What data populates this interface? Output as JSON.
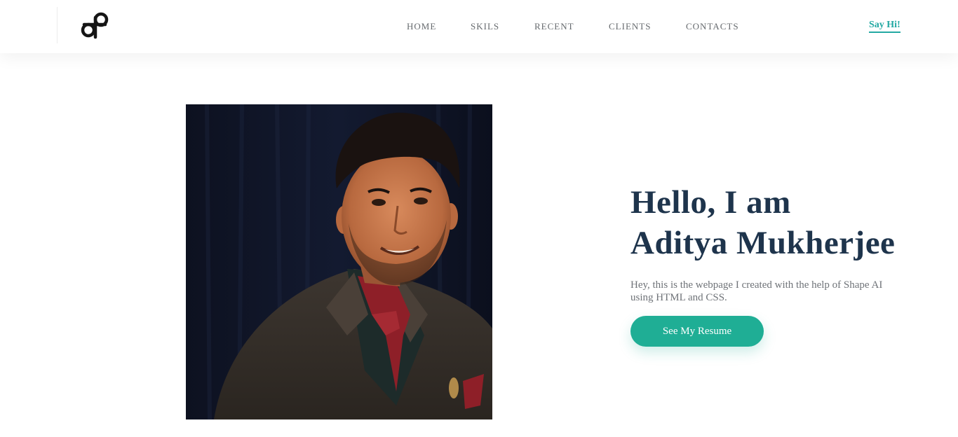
{
  "header": {
    "logo": "logo-icon",
    "nav": [
      {
        "label": "HOME"
      },
      {
        "label": "SKILS"
      },
      {
        "label": "RECENT"
      },
      {
        "label": "CLIENTS"
      },
      {
        "label": "CONTACTS"
      }
    ],
    "cta_label": "Say Hi!"
  },
  "hero": {
    "title_line1": "Hello, I am",
    "title_line2": "Aditya Mukherjee",
    "description": "Hey, this is the webpage I created with the help of Shape AI using HTML and CSS.",
    "button_label": "See My Resume"
  },
  "colors": {
    "accent": "#24a9a3",
    "button": "#1fae95",
    "heading": "#1e344c",
    "body_text": "#6f7378",
    "nav_text": "#666a6e"
  }
}
